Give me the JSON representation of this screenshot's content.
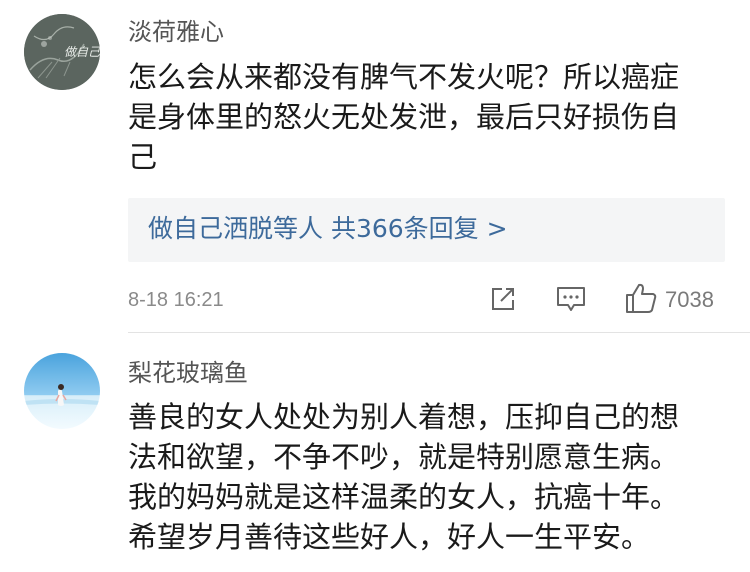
{
  "comments": [
    {
      "username": "淡荷雅心",
      "avatar_icon": "ink-painting-avatar",
      "text_lines": [
        "怎么会从来都没有脾气不发火呢？所以癌症",
        "是身体里的怒火无处发泄，最后只好损伤自",
        "己"
      ],
      "replies_label": "做自己洒脱等人  共366条回复 >",
      "time": "8-18 16:21",
      "like_count": "7038"
    },
    {
      "username": "梨花玻璃鱼",
      "avatar_icon": "beach-photo-avatar",
      "text_lines": [
        "善良的女人处处为别人着想，压抑自己的想",
        "法和欲望，不争不吵，就是特别愿意生病。",
        "我的妈妈就是这样温柔的女人，抗癌十年。",
        "希望岁月善待这些好人，好人一生平安。"
      ]
    }
  ],
  "colors": {
    "link": "#3d6a9b",
    "reply_bg": "#f4f5f6",
    "meta": "#8a8a8a"
  },
  "icons": {
    "share": "share-icon",
    "comment": "comment-icon",
    "like": "thumbs-up-icon"
  }
}
